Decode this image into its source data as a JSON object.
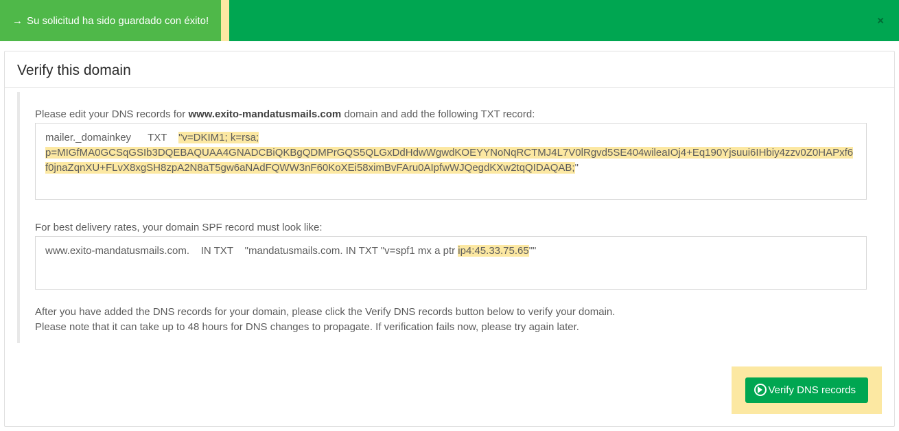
{
  "alert": {
    "arrow": "→",
    "message": "Su solicitud ha sido guardado con éxito!",
    "close": "×"
  },
  "panel": {
    "title": "Verify this domain",
    "dns_intro_pre": "Please edit your DNS records for ",
    "domain": "www.exito-mandatusmails.com",
    "dns_intro_post": " domain and add the following TXT record:",
    "dkim": {
      "host": "mailer._domainkey",
      "type": "TXT",
      "value_prefix": "\"v=DKIM1; k=rsa;",
      "value_key_line1": "p=MIGfMA0GCSqGSIb3DQEBAQUAA4GNADCBiQKBgQDMPrGQS5QLGxDdHdwWgwdKOEYYNoNqRCTMJ4L7V0lRgvd5SE404wileaIOj4+Eq190Yjsuui6IHbiy4zzv0Z0HAPxf6",
      "value_key_line2": "f0jnaZqnXU+FLvX8xgSH8zpA2N8aT5gw6aNAdFQWW3nF60KoXEi58ximBvFAru0AIpfwWJQegdKXw2tqQIDAQAB;",
      "value_suffix": "\""
    },
    "spf_intro": "For best delivery rates, your domain SPF record must look like:",
    "spf": {
      "host": "www.exito-mandatusmails.com.",
      "in_txt": "IN TXT",
      "value_pre": "\"mandatusmails.com.  IN TXT \"v=spf1 mx a ptr ",
      "ip": "ip4:45.33.75.65",
      "value_post": "\"\""
    },
    "after1": "After you have added the DNS records for your domain, please click the Verify DNS records button below to verify your domain.",
    "after2": "Please note that it can take up to 48 hours for DNS changes to propagate. If verification fails now, please try again later.",
    "verify_btn": "Verify DNS records"
  }
}
